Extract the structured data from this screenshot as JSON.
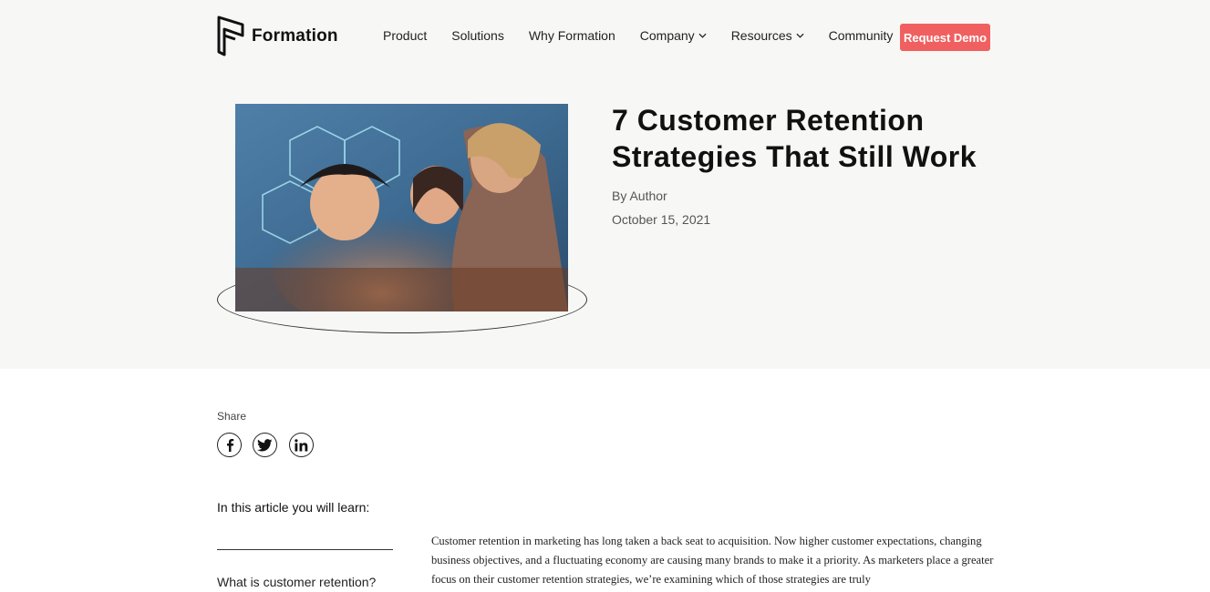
{
  "header": {
    "brand": "Formation",
    "nav": [
      {
        "label": "Product",
        "dropdown": false
      },
      {
        "label": "Solutions",
        "dropdown": false
      },
      {
        "label": "Why Formation",
        "dropdown": false
      },
      {
        "label": "Company",
        "dropdown": true
      },
      {
        "label": "Resources",
        "dropdown": true
      },
      {
        "label": "Community",
        "dropdown": false
      }
    ],
    "cta_label": "Request Demo"
  },
  "hero": {
    "title": "7 Customer Retention Strategies That Still Work",
    "author": "By Author",
    "date": "October 15, 2021"
  },
  "share": {
    "label": "Share",
    "icons": [
      "facebook-icon",
      "twitter-icon",
      "linkedin-icon"
    ]
  },
  "toc": {
    "heading": "In this article you will learn:",
    "items": [
      "What is customer retention?"
    ]
  },
  "article": {
    "intro": "Customer retention in marketing has long taken a back seat to acquisition. Now higher customer expectations, changing business objectives, and a fluctuating economy are causing many brands to make it a priority. As marketers place a greater focus on their customer retention strategies, we’re examining which of those strategies are truly"
  },
  "colors": {
    "accent": "#f06060",
    "hero_background": "#f7f7f6",
    "text": "#111111"
  }
}
